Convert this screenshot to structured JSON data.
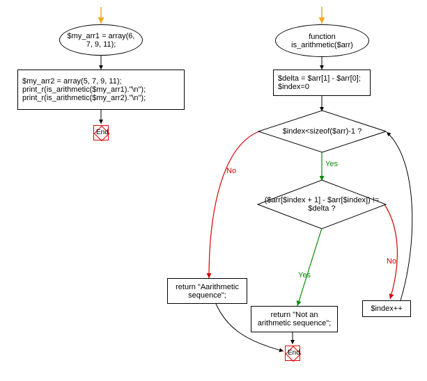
{
  "flow": {
    "leftStart": "$my_arr1 = array(6, 7, 9, 11);",
    "leftProcess": "$my_arr2 = array(5, 7, 9, 11);\nprint_r(is_arithmetic($my_arr1).\"\\n\");\nprint_r(is_arithmetic($my_arr2).\"\\n\");",
    "endLabel1": "End",
    "funcStart": "function is_arithmetic($arr)",
    "funcInit": "$delta = $arr[1] - $arr[0];\n$index=0",
    "cond1": "$index<sizeof($arr)-1 ?",
    "cond2": "($arr[$index + 1] - $arr[$index]) != $delta ?",
    "returnA": "return \"Aarithmetic sequence\";",
    "returnB": "return \"Not an arithmetic sequence\";",
    "increment": "$index++",
    "endLabel2": "End",
    "yes": "Yes",
    "no": "No"
  }
}
